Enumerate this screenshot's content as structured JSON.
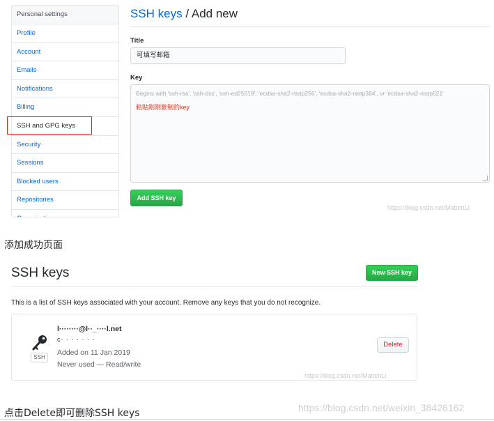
{
  "settings_sidebar": {
    "header": "Personal settings",
    "items": [
      {
        "label": "Profile"
      },
      {
        "label": "Account"
      },
      {
        "label": "Emails"
      },
      {
        "label": "Notifications"
      },
      {
        "label": "Billing"
      },
      {
        "label": "SSH and GPG keys",
        "selected": true
      },
      {
        "label": "Security"
      },
      {
        "label": "Sessions"
      },
      {
        "label": "Blocked users"
      },
      {
        "label": "Repositories"
      },
      {
        "label": "Organizations"
      }
    ],
    "highlight_color": "#e0271f"
  },
  "add_form": {
    "breadcrumb_link": "SSH keys",
    "breadcrumb_separator": " / ",
    "breadcrumb_current": "Add new",
    "title_label": "Title",
    "title_value": "可填写邮箱",
    "key_label": "Key",
    "key_placeholder": "Begins with 'ssh-rsa', 'ssh-dss', 'ssh-ed25519', 'ecdsa-sha2-nistp256', 'ecdsa-sha2-nistp384', or 'ecdsa-sha2-nistp521'",
    "key_note": "粘贴刚刚复制的key",
    "submit_label": "Add SSH key",
    "watermark": "https://blog.csdn.net/MattenLi"
  },
  "caption_success": "添加成功页面",
  "keys_list": {
    "heading": "SSH keys",
    "new_button_label": "New SSH key",
    "description": "This is a list of SSH keys associated with your account. Remove any keys that you do not recognize.",
    "keys": [
      {
        "title": "l········@l··_····l.net",
        "fingerprint": "c·  ·  ·   ·    ·   ·    ·",
        "badge": "SSH",
        "added": "Added on 11 Jan 2019",
        "usage": "Never used — Read/write",
        "delete_label": "Delete"
      }
    ],
    "watermark": "https://blog.csdn.net/MattenLi"
  },
  "caption_delete": "点击Delete即可删除SSH keys",
  "page_watermark": "https://blog.csdn.net/weixin_38426162",
  "colors": {
    "link": "#0366d6",
    "primary_button": "#2ea44f",
    "danger": "#cb2431",
    "border": "#e1e4e8"
  },
  "icons": [
    "key-icon"
  ]
}
